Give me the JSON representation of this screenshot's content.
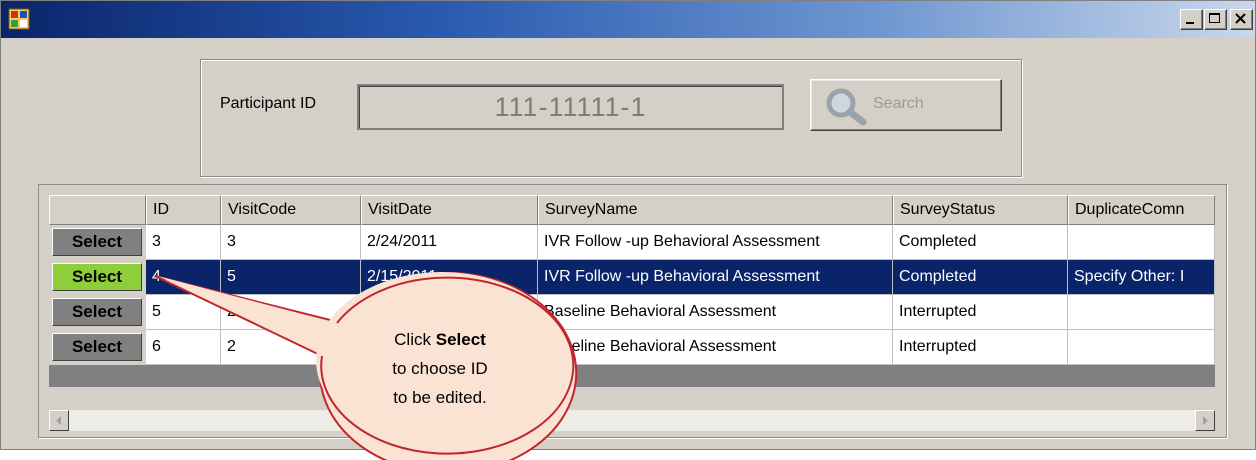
{
  "window": {
    "controls": [
      "minimize",
      "maximize",
      "close"
    ]
  },
  "search": {
    "label": "Participant ID",
    "value": "111-11111-1",
    "button_label": "Search"
  },
  "grid": {
    "columns": [
      "",
      "ID",
      "VisitCode",
      "VisitDate",
      "SurveyName",
      "SurveyStatus",
      "DuplicateComn"
    ],
    "select_label": "Select",
    "rows": [
      {
        "id": "3",
        "visit_code": "3",
        "visit_date": "2/24/2011",
        "survey_name": "IVR Follow -up Behavioral Assessment",
        "survey_status": "Completed",
        "duplicate": "",
        "selected": false
      },
      {
        "id": "4",
        "visit_code": "5",
        "visit_date": "2/15/2011",
        "survey_name": "IVR Follow -up Behavioral Assessment",
        "survey_status": "Completed",
        "duplicate": "Specify Other: I",
        "selected": true
      },
      {
        "id": "5",
        "visit_code": "2",
        "visit_date": "",
        "survey_name": "Baseline Behavioral Assessment",
        "survey_status": "Interrupted",
        "duplicate": "",
        "selected": false
      },
      {
        "id": "6",
        "visit_code": "2",
        "visit_date": "",
        "survey_name": "Baseline Behavioral Assessment",
        "survey_status": "Interrupted",
        "duplicate": "",
        "selected": false
      }
    ]
  },
  "callout": {
    "line1_prefix": "Click",
    "line1_bold": "Select",
    "line2": "to choose ID",
    "line3": "to be edited."
  },
  "colors": {
    "selected_row": "#0a246a",
    "active_select_button": "#8fce3b",
    "callout_fill": "#fbe3d4",
    "callout_stroke": "#c0272d"
  }
}
